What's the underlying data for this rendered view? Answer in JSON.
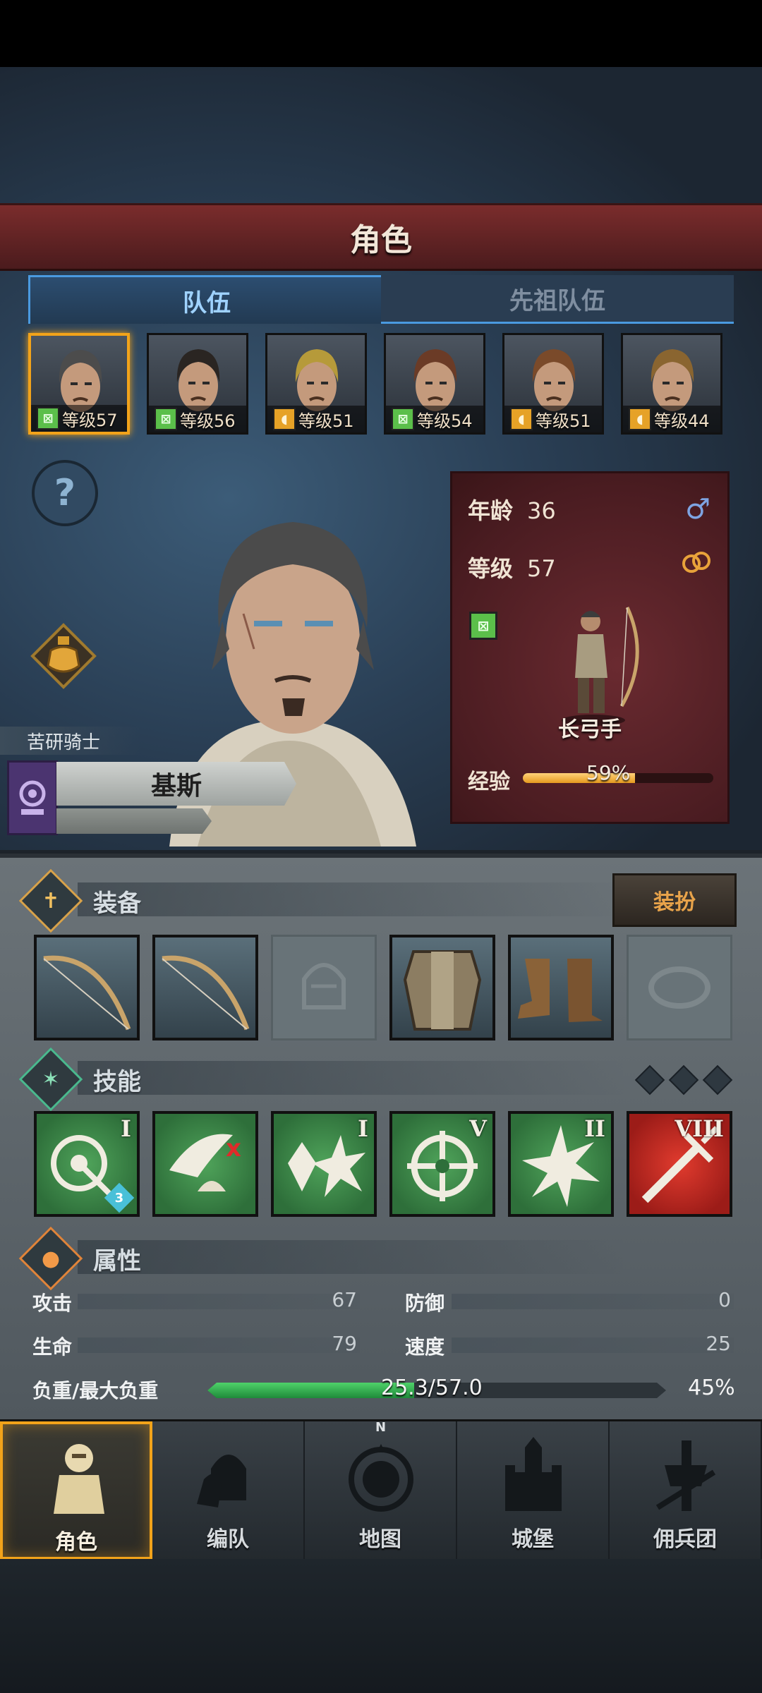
{
  "header": {
    "title": "角色"
  },
  "tabs": [
    {
      "label": "队伍"
    },
    {
      "label": "先祖队伍"
    }
  ],
  "roster": [
    {
      "level_text": "等级57",
      "class": "green",
      "hair": "#4c4c4c",
      "selected": true
    },
    {
      "level_text": "等级56",
      "class": "green",
      "hair": "#2a2522",
      "selected": false
    },
    {
      "level_text": "等级51",
      "class": "gold",
      "hair": "#b69a3a",
      "selected": false
    },
    {
      "level_text": "等级54",
      "class": "green",
      "hair": "#6b3b26",
      "selected": false
    },
    {
      "level_text": "等级51",
      "class": "gold",
      "hair": "#7a4a2a",
      "selected": false
    },
    {
      "level_text": "等级44",
      "class": "gold",
      "hair": "#8a6530",
      "selected": false
    }
  ],
  "character": {
    "title": "苦研骑士",
    "name": "基斯",
    "age_label": "年龄",
    "age": "36",
    "level_label": "等级",
    "level": "57",
    "class_name": "长弓手",
    "exp_label": "经验",
    "exp_percent": "59%",
    "exp_fraction": 0.59
  },
  "sections": {
    "equipment": "装备",
    "skills": "技能",
    "attributes": "属性",
    "dress_button": "装扮"
  },
  "equipment": [
    {
      "item": "bow-icon",
      "filled": true
    },
    {
      "item": "bow-icon",
      "filled": true
    },
    {
      "item": "helmet-icon",
      "filled": false
    },
    {
      "item": "armor-icon",
      "filled": true
    },
    {
      "item": "boots-icon",
      "filled": true
    },
    {
      "item": "ring-icon",
      "filled": false
    }
  ],
  "skills": [
    {
      "icon": "target-arrow-icon",
      "rank": "I",
      "color": "green",
      "badge": "3"
    },
    {
      "icon": "bird-hit-icon",
      "rank": "",
      "color": "green",
      "badge": ""
    },
    {
      "icon": "crystal-burst-icon",
      "rank": "I",
      "color": "green",
      "badge": ""
    },
    {
      "icon": "crosshair-icon",
      "rank": "V",
      "color": "green",
      "badge": ""
    },
    {
      "icon": "burst-icon",
      "rank": "II",
      "color": "green",
      "badge": ""
    },
    {
      "icon": "sword-icon",
      "rank": "VIII",
      "color": "red",
      "badge": ""
    }
  ],
  "attributes": {
    "attack_label": "攻击",
    "attack": "67",
    "defense_label": "防御",
    "defense": "0",
    "hp_label": "生命",
    "hp": "79",
    "speed_label": "速度",
    "speed": "25",
    "load_label": "负重/最大负重",
    "load_text": "25.3/57.0",
    "load_percent": "45%",
    "load_fraction": 0.45
  },
  "nav": [
    {
      "label": "角色",
      "icon": "knight-icon",
      "active": true
    },
    {
      "label": "编队",
      "icon": "helmet-group-icon",
      "active": false
    },
    {
      "label": "地图",
      "icon": "compass-map-icon",
      "active": false
    },
    {
      "label": "城堡",
      "icon": "castle-icon",
      "active": false
    },
    {
      "label": "佣兵团",
      "icon": "mercenary-banner-icon",
      "active": false
    }
  ],
  "colors": {
    "accent_gold": "#f2a31a",
    "tab_blue": "#4a9ae0",
    "exp_orange": "#e59a1e",
    "load_green": "#1f8a3a"
  }
}
